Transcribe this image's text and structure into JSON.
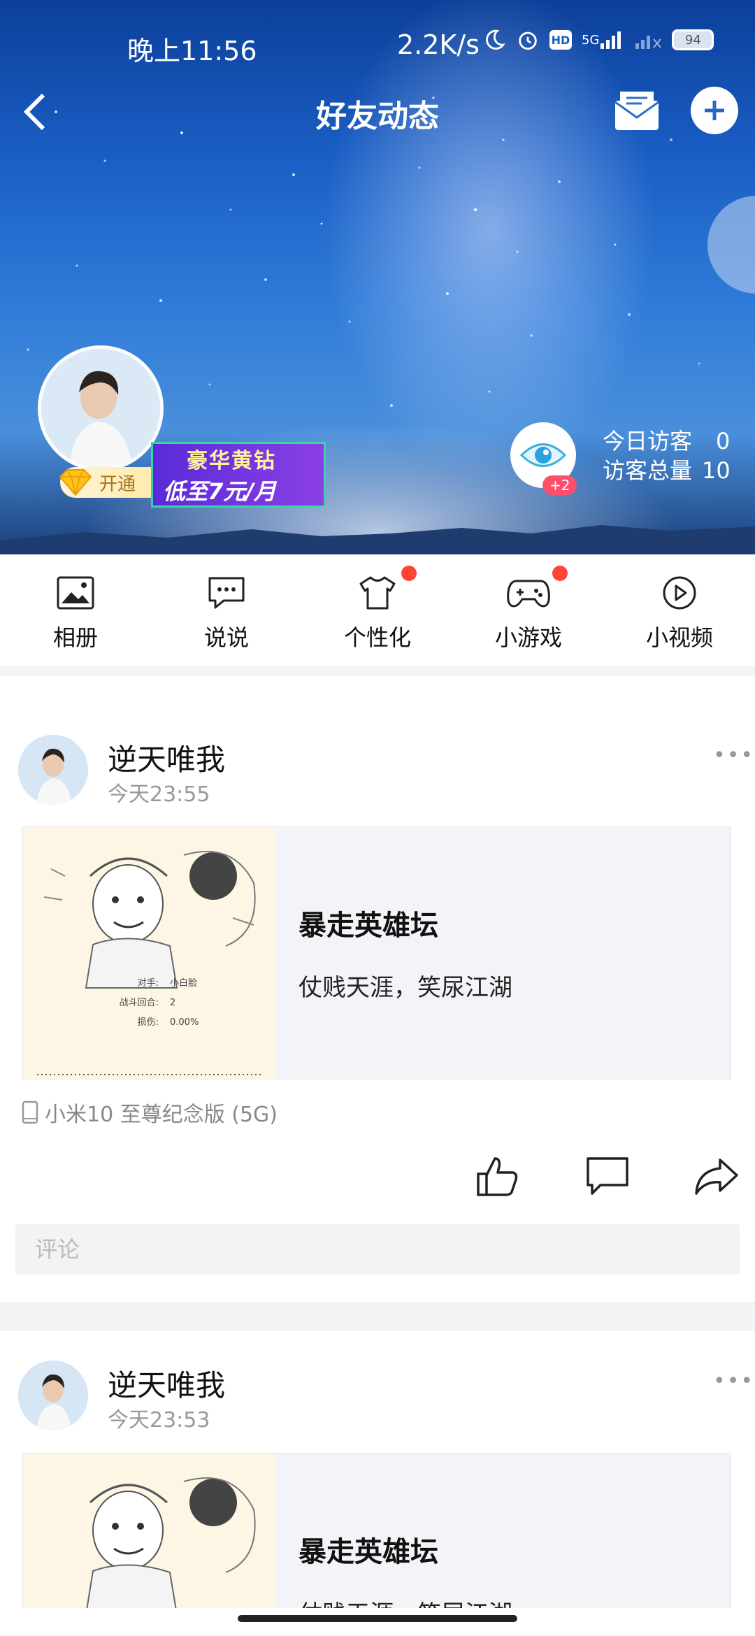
{
  "status_bar": {
    "time": "晚上11:56",
    "net_speed": "2.2K/s",
    "network": "5G",
    "hd_badge": "HD",
    "battery": "94"
  },
  "header": {
    "title": "好友动态"
  },
  "profile": {
    "open_badge": "开通",
    "vip_line1": "豪华黄钻",
    "vip_line2": "低至7元/月",
    "eye_badge": "+2",
    "visitors_today_label": "今日访客",
    "visitors_today_value": "0",
    "visitors_total_label": "访客总量",
    "visitors_total_value": "10"
  },
  "quick_menu": [
    {
      "label": "相册",
      "icon": "photo-album-icon",
      "dot": false
    },
    {
      "label": "说说",
      "icon": "chat-bubble-icon",
      "dot": false
    },
    {
      "label": "个性化",
      "icon": "tshirt-icon",
      "dot": true
    },
    {
      "label": "小游戏",
      "icon": "gamepad-icon",
      "dot": true
    },
    {
      "label": "小视频",
      "icon": "play-video-icon",
      "dot": false
    }
  ],
  "posts": [
    {
      "author": "逆天唯我",
      "time": "今天23:55",
      "more": "•••",
      "card_title": "暴走英雄坛",
      "card_desc": "仗贱天涯，笑尿江湖",
      "card_img_lines": [
        "对手:",
        "小白脸",
        "战斗回合:",
        "2",
        "损伤:",
        "0.00%"
      ],
      "device": "小米10 至尊纪念版 (5G)",
      "comment_placeholder": "评论"
    },
    {
      "author": "逆天唯我",
      "time": "今天23:53",
      "more": "•••",
      "card_title": "暴走英雄坛",
      "card_desc": "仗贱天涯，笑尿江湖"
    }
  ],
  "colors": {
    "accent_red": "#ff4436",
    "separator": "#f2f3f5",
    "card_bg": "#f3f4f8",
    "muted_text": "#999999"
  }
}
